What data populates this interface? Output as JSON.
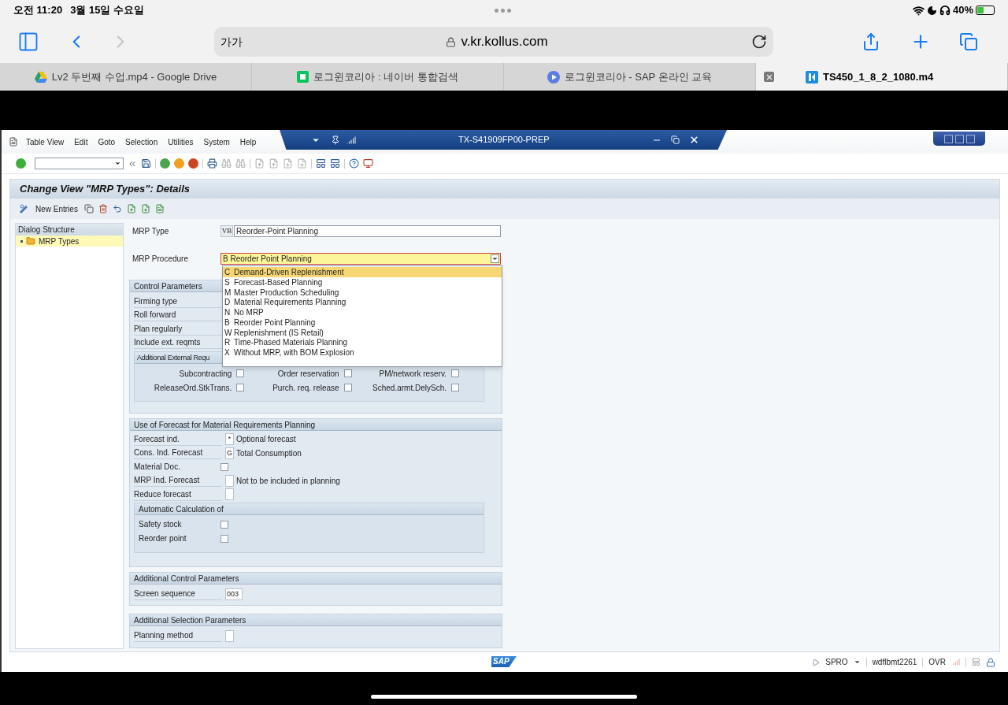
{
  "device_status": {
    "time": "오전 11:20",
    "date": "3월 15일 수요일",
    "battery": "40%"
  },
  "browser": {
    "text_size": "가가",
    "url": "v.kr.kollus.com",
    "tabs": [
      {
        "kind": "drive",
        "label": "Lv2 두번째 수업.mp4 - Google Drive",
        "selected": false
      },
      {
        "kind": "naver",
        "label": "로그윈코리아 : 네이버 통합검색",
        "selected": false
      },
      {
        "kind": "play",
        "label": "로그윈코리아 - SAP 온라인 교육",
        "selected": false
      },
      {
        "kind": "video",
        "label": "TS450_1_8_2_1080.m4",
        "selected": true
      }
    ]
  },
  "sap": {
    "menu": [
      "Table View",
      "Edit",
      "Goto",
      "Selection",
      "Utilities",
      "System",
      "Help"
    ],
    "window_title": "TX-S41909FP00-PREP",
    "screen_title": "Change View \"MRP Types\": Details",
    "new_entries": "New Entries",
    "dialog_structure": {
      "title": "Dialog Structure",
      "items": [
        {
          "label": "MRP Types",
          "selected": true
        }
      ]
    },
    "mrp_type": {
      "label": "MRP Type",
      "code": "VB",
      "value": "Reorder-Point Planning"
    },
    "mrp_procedure": {
      "label": "MRP Procedure",
      "value": "B Reorder Point Planning",
      "options": [
        {
          "code": "C",
          "label": "Demand-Driven Replenishment",
          "selected": true
        },
        {
          "code": "S",
          "label": "Forecast-Based Planning",
          "selected": false
        },
        {
          "code": "M",
          "label": "Master Production Scheduling",
          "selected": false
        },
        {
          "code": "D",
          "label": "Material Requirements Planning",
          "selected": false
        },
        {
          "code": "N",
          "label": "No MRP",
          "selected": false
        },
        {
          "code": "B",
          "label": "Reorder Point Planning",
          "selected": false
        },
        {
          "code": "W",
          "label": "Replenishment (IS Retail)",
          "selected": false
        },
        {
          "code": "R",
          "label": "Time-Phased Materials Planning",
          "selected": false
        },
        {
          "code": "X",
          "label": "Without MRP, with BOM Explosion",
          "selected": false
        }
      ]
    },
    "control_parameters": {
      "title": "Control Parameters",
      "rows": [
        "Firming type",
        "Roll forward",
        "Plan regularly",
        "Include ext. reqmts"
      ],
      "external": {
        "title": "Additional External Requ",
        "checkboxes": [
          {
            "label": "Subcontracting",
            "checked": false
          },
          {
            "label": "Order reservation",
            "checked": false
          },
          {
            "label": "PM/network reserv.",
            "checked": false
          },
          {
            "label": "ReleaseOrd.StkTrans.",
            "checked": false
          },
          {
            "label": "Purch. req. release",
            "checked": false
          },
          {
            "label": "Sched.armt.DelySch.",
            "checked": false
          }
        ]
      }
    },
    "forecast": {
      "title": "Use of Forecast for Material Requirements Planning",
      "rows": [
        {
          "kind": "code",
          "label": "Forecast ind.",
          "code": "*",
          "text": "Optional forecast"
        },
        {
          "kind": "code",
          "label": "Cons. Ind. Forecast",
          "code": "G",
          "text": "Total Consumption"
        },
        {
          "kind": "checkbox",
          "label": "Material Doc.",
          "checked": false
        },
        {
          "kind": "code",
          "label": "MRP Ind. Forecast",
          "text": "Not to be included in planning"
        },
        {
          "kind": "code",
          "label": "Reduce forecast"
        }
      ],
      "automatic": {
        "title": "Automatic Calculation of",
        "checkboxes": [
          {
            "label": "Safety stock",
            "checked": false
          },
          {
            "label": "Reorder point",
            "checked": false
          }
        ]
      }
    },
    "additional_control": {
      "title": "Additional Control Parameters",
      "rows": [
        {
          "label": "Screen sequence",
          "value": "003"
        }
      ]
    },
    "additional_selection": {
      "title": "Additional Selection Parameters",
      "rows": [
        {
          "label": "Planning method"
        }
      ]
    },
    "status": {
      "logo": "SAP",
      "transaction": "SPRO",
      "server": "wdflbmt2261",
      "mode": "OVR"
    }
  }
}
